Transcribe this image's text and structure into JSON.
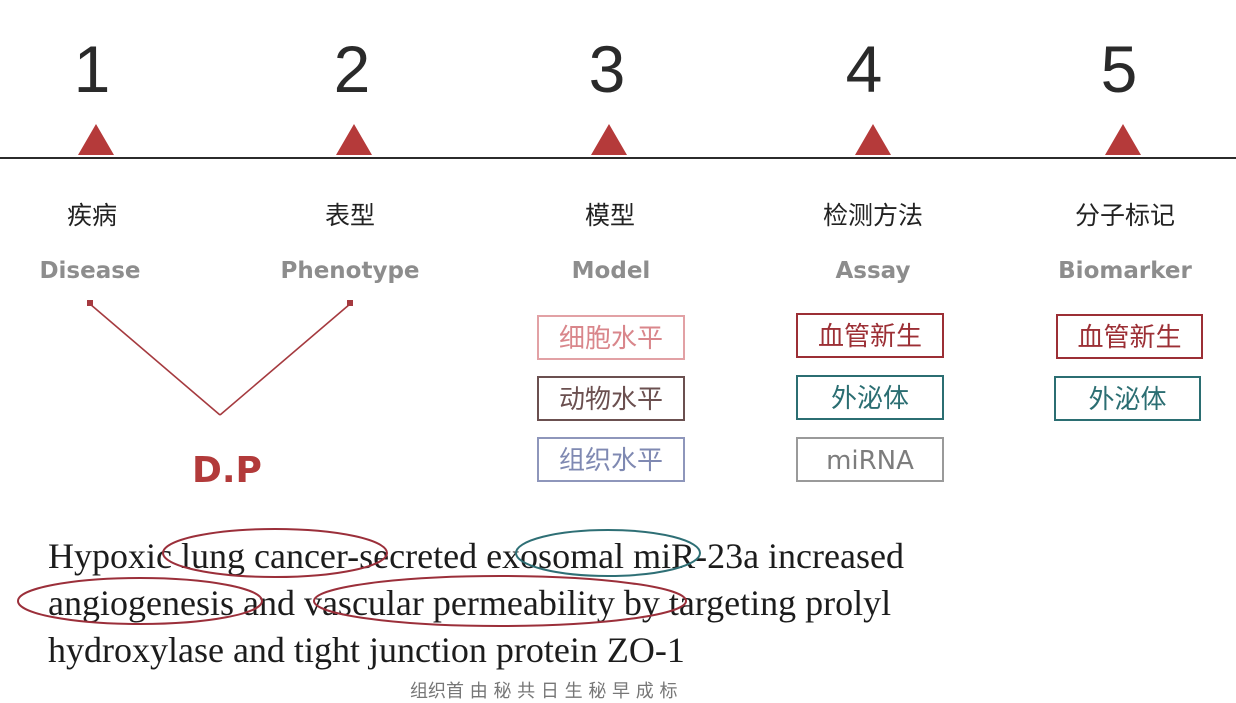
{
  "steps": [
    {
      "number": "1",
      "zh": "疾病",
      "en": "Disease"
    },
    {
      "number": "2",
      "zh": "表型",
      "en": "Phenotype"
    },
    {
      "number": "3",
      "zh": "模型",
      "en": "Model"
    },
    {
      "number": "4",
      "zh": "检测方法",
      "en": "Assay"
    },
    {
      "number": "5",
      "zh": "分子标记",
      "en": "Biomarker"
    }
  ],
  "merge_label": "D.P",
  "model_boxes": [
    "细胞水平",
    "动物水平",
    "组织水平"
  ],
  "assay_boxes": [
    "血管新生",
    "外泌体",
    "miRNA"
  ],
  "biomarker_boxes": [
    "血管新生",
    "外泌体"
  ],
  "colors": {
    "accent_red": "#b53a3a",
    "box_red": "#9c2f35",
    "box_pink": "#d9868b",
    "box_brown": "#6b5050",
    "box_blue": "#7f89b2",
    "box_teal": "#2b6e72",
    "box_gray": "#9a9a9a",
    "circle_red": "#9b2f3a",
    "circle_teal": "#2e6f75"
  },
  "title_sentence": {
    "line1": {
      "part1": "Hypoxic ",
      "part2": "lung cancer",
      "part3": "-secreted ",
      "part4": "exosomal",
      "part5": " miR-23a increased"
    },
    "line2": {
      "part1": "angiogenesis",
      "part2": " and ",
      "part3": "vascular permeability",
      "part4": " by targeting prolyl"
    },
    "line3": "hydroxylase and tight junction protein ZO-1"
  },
  "caption": "组织首 由 秘 共 日 生 秘 早 成 标"
}
